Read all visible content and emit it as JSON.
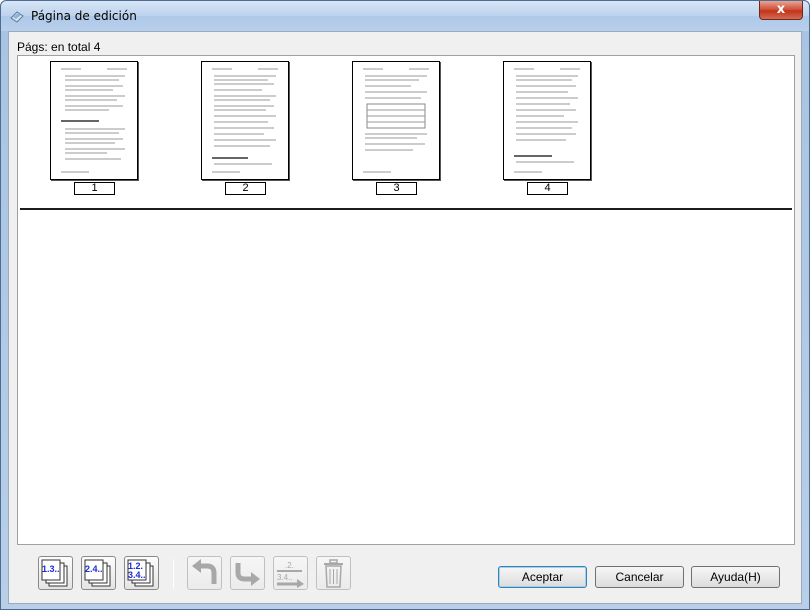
{
  "window": {
    "title": "Página de edición",
    "close_symbol": "x"
  },
  "panel": {
    "total_label": "Págs: en total 4"
  },
  "pages": [
    {
      "number": "1"
    },
    {
      "number": "2"
    },
    {
      "number": "3"
    },
    {
      "number": "4"
    }
  ],
  "toolbar": {
    "odd_pages_label": "1.3..",
    "even_pages_label": "2.4..",
    "all_pages_label_top": "1.2.",
    "all_pages_label_bottom": "3.4..",
    "reorder_label_top": ".2.",
    "reorder_label_bottom": "3.4.."
  },
  "buttons": {
    "accept": "Aceptar",
    "cancel": "Cancelar",
    "help": "Ayuda(H)"
  },
  "colors": {
    "page_number_blue": "#1a2ed8",
    "disabled_gray": "#a8a8a8"
  },
  "icons": {
    "title": "scanner-icon",
    "rotate_left": "rotate-left-icon",
    "rotate_right": "rotate-right-icon",
    "delete": "trash-icon"
  }
}
